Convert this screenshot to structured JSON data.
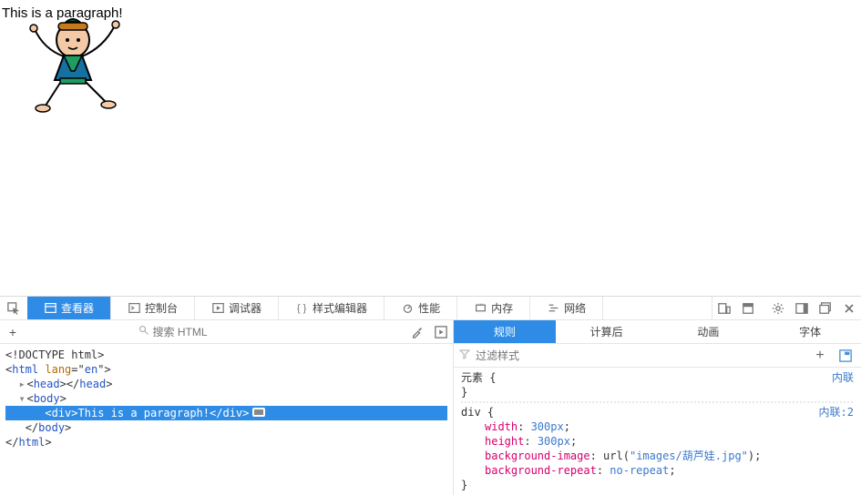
{
  "preview": {
    "paragraph_text": "This is a paragraph!"
  },
  "devtools": {
    "tabs": {
      "inspector": "查看器",
      "console": "控制台",
      "debugger": "调试器",
      "styleeditor": "样式编辑器",
      "performance": "性能",
      "memory": "内存",
      "network": "网络"
    },
    "search": {
      "placeholder": "搜索 HTML"
    },
    "dom": {
      "doctype": "<!DOCTYPE html>",
      "html_open": "html",
      "lang_attr": "lang",
      "lang_val": "en",
      "head": "head",
      "body": "body",
      "div": "div",
      "div_text": "This is a paragraph!"
    },
    "rules": {
      "subtabs": {
        "rules": "规则",
        "computed": "计算后",
        "animations": "动画",
        "fonts": "字体"
      },
      "filter_placeholder": "过滤样式",
      "inline_label": "内联",
      "inline_label2": "内联:2",
      "element_selector": "元素",
      "div_selector": "div",
      "decls": {
        "width": {
          "prop": "width",
          "val": "300px"
        },
        "height": {
          "prop": "height",
          "val": "300px"
        },
        "bgimg": {
          "prop": "background-image",
          "fn": "url",
          "arg": "\"images/葫芦娃.jpg\""
        },
        "bgrepeat": {
          "prop": "background-repeat",
          "val": "no-repeat"
        }
      }
    }
  }
}
